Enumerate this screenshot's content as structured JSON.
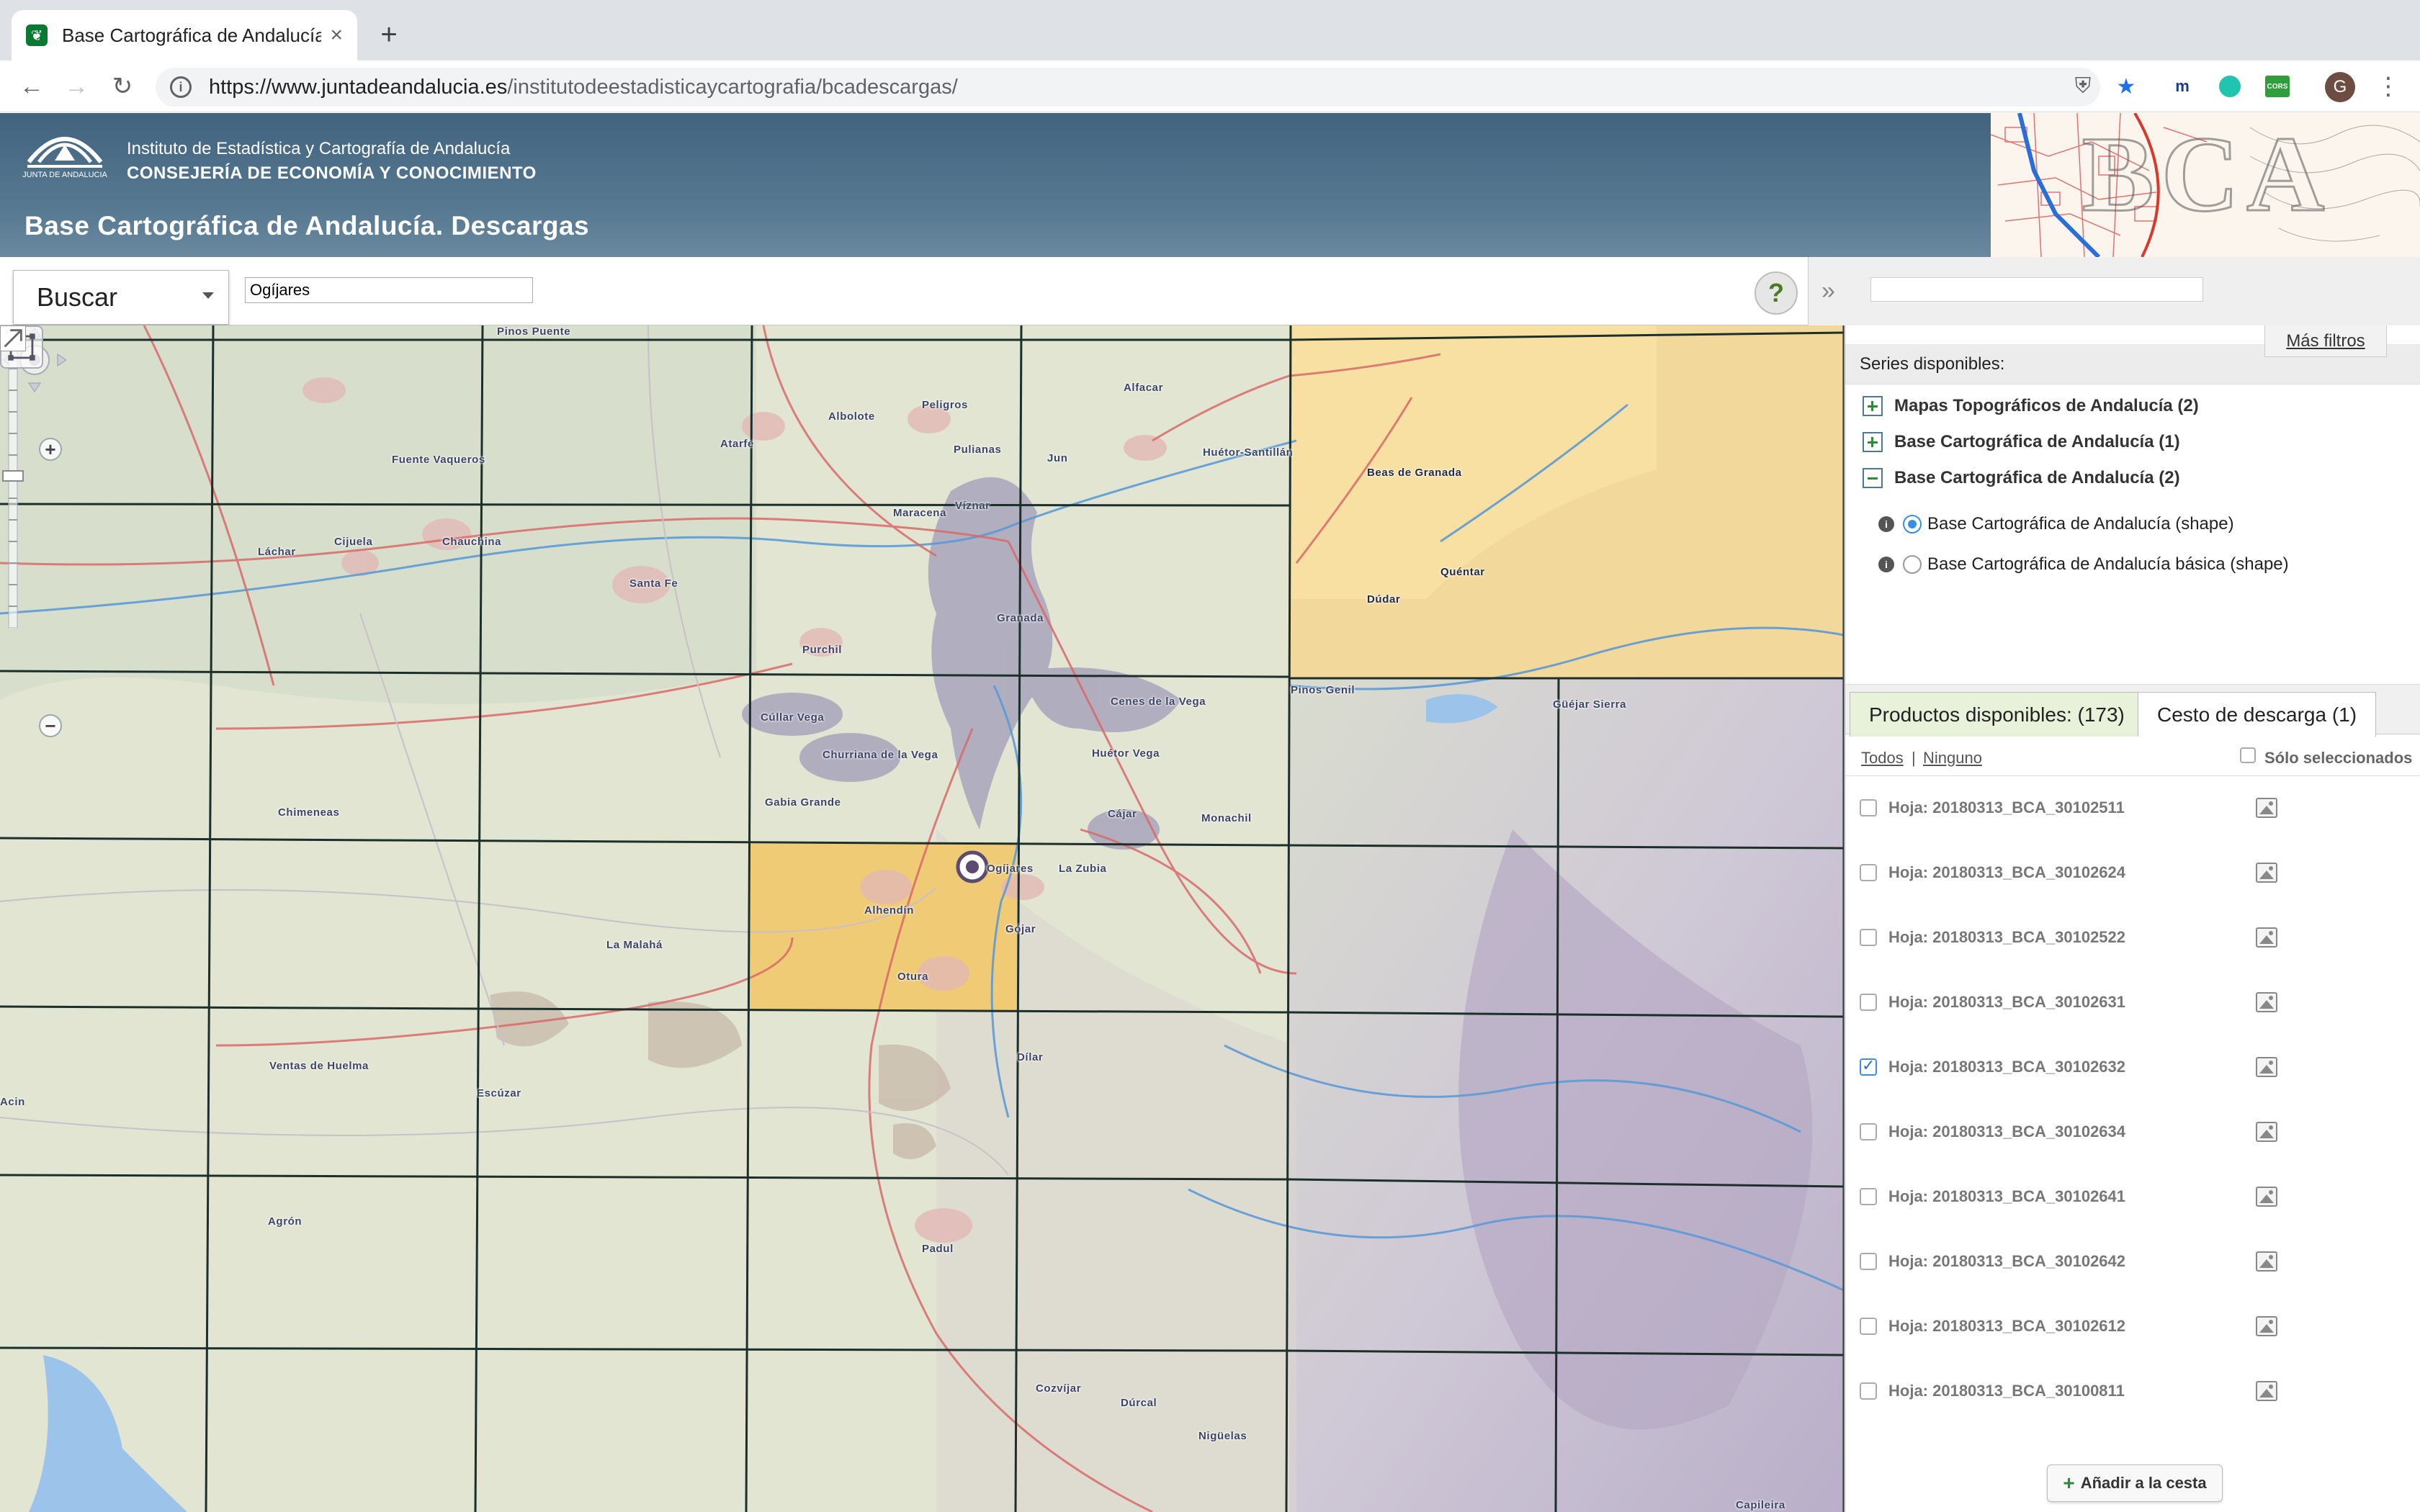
{
  "browser": {
    "tab_title": "Base Cartográfica de Andalucía",
    "close_glyph": "×",
    "new_tab_glyph": "+",
    "url_host": "https://www.juntadeandalucia.es",
    "url_path": "/institutodeestadisticaycartografia/bcadescargas/",
    "avatar_letter": "G",
    "extensions": [
      "shield-extension-icon",
      "star-bookmark-icon",
      "movistar-extension-icon",
      "chat-extension-icon",
      "cors-extension-icon"
    ],
    "cors_label": "CORS"
  },
  "header": {
    "logo_caption": "JUNTA DE ANDALUCIA",
    "institute": "Instituto de Estadística y Cartografía de Andalucía",
    "department": "CONSEJERÍA DE ECONOMÍA Y CONOCIMIENTO",
    "title": "Base Cartográfica de Andalucía. Descargas",
    "banner_letters": "BCA"
  },
  "search": {
    "mode_label": "Buscar",
    "value": "Ogíjares",
    "help_label": "?"
  },
  "panel": {
    "collapse_glyph": "»",
    "filter_value": "",
    "more_filters": "Más filtros",
    "series_heading": "Series disponibles:",
    "series": [
      {
        "label": "Mapas Topográficos de Andalucía (2)",
        "expanded": false
      },
      {
        "label": "Base Cartográfica de Andalucía (1)",
        "expanded": false
      },
      {
        "label": "Base Cartográfica de Andalucía (2)",
        "expanded": true
      }
    ],
    "options": [
      {
        "label": "Base Cartográfica de Andalucía (shape)",
        "selected": true
      },
      {
        "label": "Base Cartográfica de Andalucía básica (shape)",
        "selected": false
      }
    ],
    "tabs": {
      "products": "Productos disponibles: (173)",
      "basket": "Cesto de descarga (1)"
    },
    "select_all": "Todos",
    "separator": "|",
    "select_none": "Ninguno",
    "only_selected": "Sólo seleccionados",
    "products": [
      {
        "label": "Hoja: 20180313_BCA_30102511",
        "checked": false
      },
      {
        "label": "Hoja: 20180313_BCA_30102624",
        "checked": false
      },
      {
        "label": "Hoja: 20180313_BCA_30102522",
        "checked": false
      },
      {
        "label": "Hoja: 20180313_BCA_30102631",
        "checked": false
      },
      {
        "label": "Hoja: 20180313_BCA_30102632",
        "checked": true
      },
      {
        "label": "Hoja: 20180313_BCA_30102634",
        "checked": false
      },
      {
        "label": "Hoja: 20180313_BCA_30102641",
        "checked": false
      },
      {
        "label": "Hoja: 20180313_BCA_30102642",
        "checked": false
      },
      {
        "label": "Hoja: 20180313_BCA_30102612",
        "checked": false
      },
      {
        "label": "Hoja: 20180313_BCA_30100811",
        "checked": false
      }
    ],
    "add_button": "Añadir a la cesta"
  },
  "map": {
    "zoom_in": "+",
    "zoom_out": "−",
    "places": [
      "Pinos Puente",
      "Peligros",
      "Alfacar",
      "Albolote",
      "Atarfe",
      "Pulianas",
      "Jun",
      "Fuente Vaqueros",
      "Víznar",
      "Huétor-Santillán",
      "Beas de Granada",
      "Láchar",
      "Cijuela",
      "Chauchina",
      "Maracena",
      "Santa Fe",
      "Granada",
      "Dúdar",
      "Quéntar",
      "Purchil",
      "Pinos Genil",
      "Güéjar Sierra",
      "Cenes de la Vega",
      "Cúllar Vega",
      "Huétor Vega",
      "Churriana de la Vega",
      "Gabia Grande",
      "Cájar",
      "Monachil",
      "Chimeneas",
      "Ogíjares",
      "La Zubia",
      "Alhendín",
      "Gójar",
      "La Malahá",
      "Otura",
      "Ventas de Huelma",
      "Escúzar",
      "Dílar",
      "Agrón",
      "Padul",
      "Cozvíjar",
      "Dúrcal",
      "Nigüelas",
      "Capileira",
      "Acin"
    ]
  }
}
